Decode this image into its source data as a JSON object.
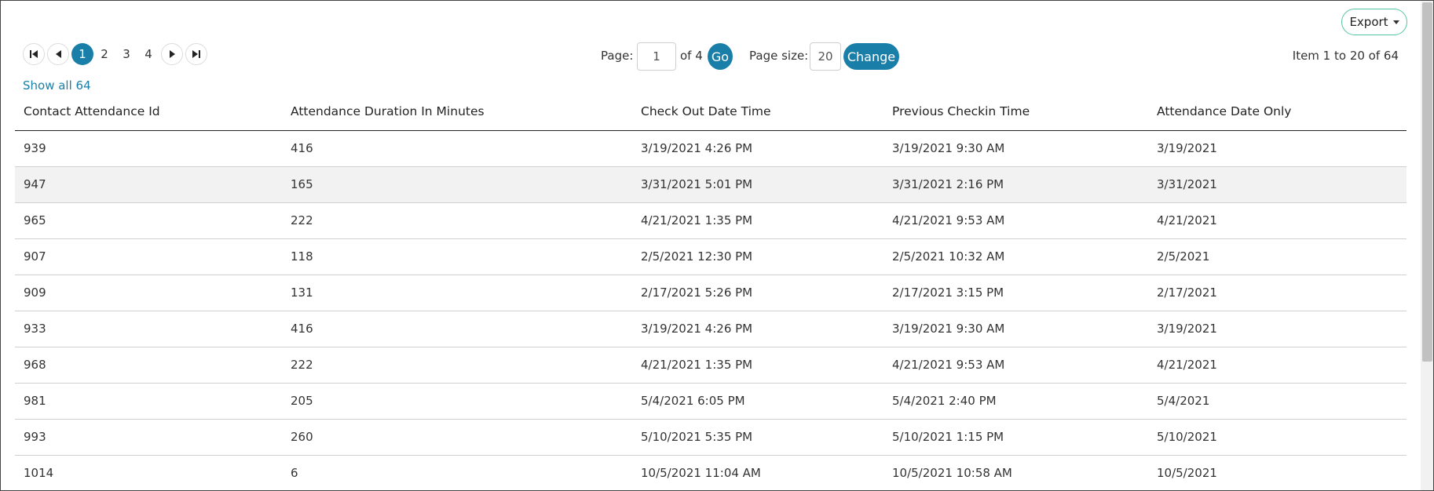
{
  "toolbar": {
    "export_label": "Export"
  },
  "pager": {
    "pages": [
      "1",
      "2",
      "3",
      "4"
    ],
    "current": "1",
    "show_all": "Show all 64"
  },
  "goto": {
    "page_label": "Page:",
    "page_value": "1",
    "of_label": "of 4",
    "go_label": "Go",
    "size_label": "Page size:",
    "size_value": "20",
    "change_label": "Change"
  },
  "items_info": "Item 1 to 20 of 64",
  "table": {
    "columns": [
      "Contact Attendance Id",
      "Attendance Duration In Minutes",
      "Check Out Date Time",
      "Previous Checkin Time",
      "Attendance Date Only"
    ],
    "rows": [
      [
        "939",
        "416",
        "3/19/2021 4:26 PM",
        "3/19/2021 9:30 AM",
        "3/19/2021"
      ],
      [
        "947",
        "165",
        "3/31/2021 5:01 PM",
        "3/31/2021 2:16 PM",
        "3/31/2021"
      ],
      [
        "965",
        "222",
        "4/21/2021 1:35 PM",
        "4/21/2021 9:53 AM",
        "4/21/2021"
      ],
      [
        "907",
        "118",
        "2/5/2021 12:30 PM",
        "2/5/2021 10:32 AM",
        "2/5/2021"
      ],
      [
        "909",
        "131",
        "2/17/2021 5:26 PM",
        "2/17/2021 3:15 PM",
        "2/17/2021"
      ],
      [
        "933",
        "416",
        "3/19/2021 4:26 PM",
        "3/19/2021 9:30 AM",
        "3/19/2021"
      ],
      [
        "968",
        "222",
        "4/21/2021 1:35 PM",
        "4/21/2021 9:53 AM",
        "4/21/2021"
      ],
      [
        "981",
        "205",
        "5/4/2021 6:05 PM",
        "5/4/2021 2:40 PM",
        "5/4/2021"
      ],
      [
        "993",
        "260",
        "5/10/2021 5:35 PM",
        "5/10/2021 1:15 PM",
        "5/10/2021"
      ],
      [
        "1014",
        "6",
        "10/5/2021 11:04 AM",
        "10/5/2021 10:58 AM",
        "10/5/2021"
      ]
    ]
  },
  "colors": {
    "accent": "#1a7fa8",
    "export_border": "#56c4a4"
  },
  "icons": {
    "first": "first-page-icon",
    "prev": "previous-page-icon",
    "next": "next-page-icon",
    "last": "last-page-icon",
    "caret": "caret-down-icon"
  }
}
